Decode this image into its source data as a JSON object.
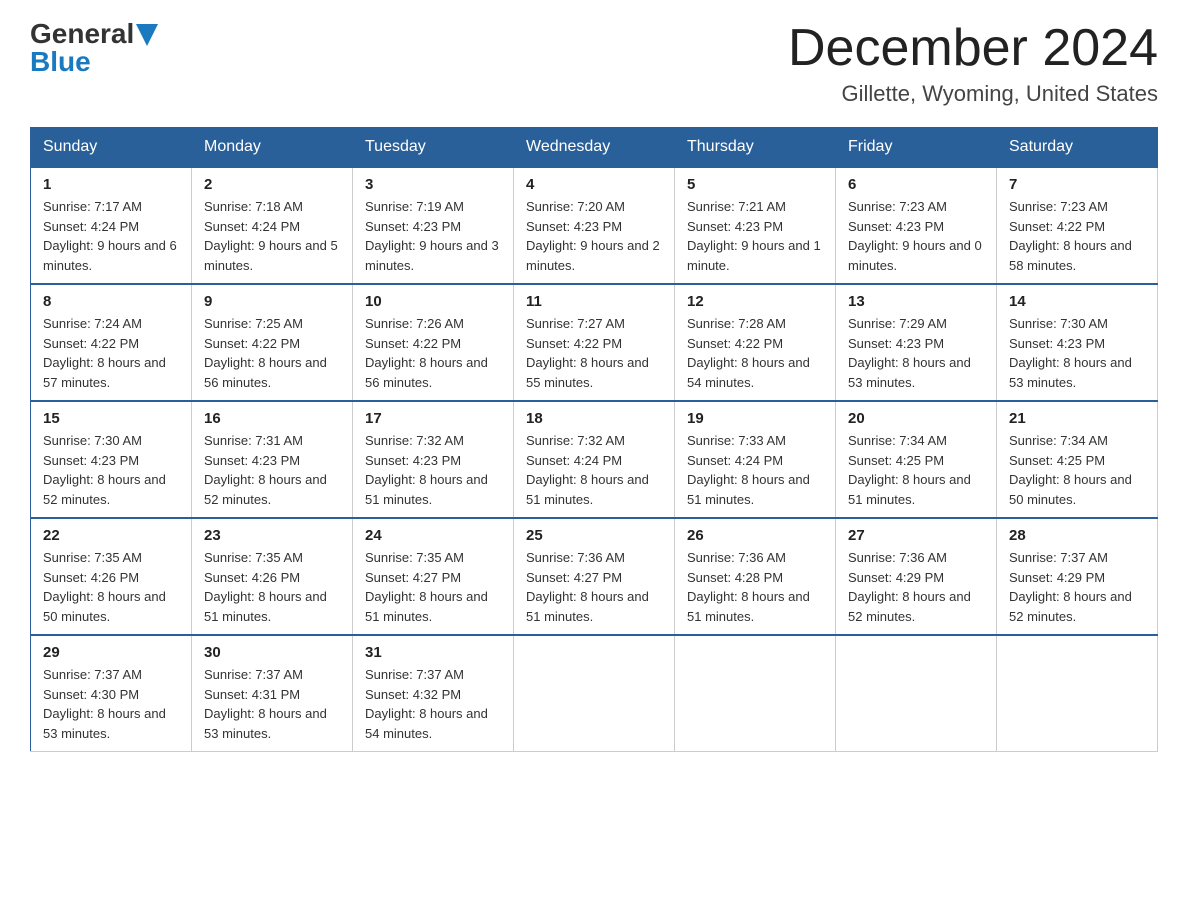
{
  "logo": {
    "general": "General",
    "blue": "Blue",
    "tagline": "GeneralBlue"
  },
  "title": "December 2024",
  "subtitle": "Gillette, Wyoming, United States",
  "days_of_week": [
    "Sunday",
    "Monday",
    "Tuesday",
    "Wednesday",
    "Thursday",
    "Friday",
    "Saturday"
  ],
  "weeks": [
    [
      {
        "day": "1",
        "sunrise": "7:17 AM",
        "sunset": "4:24 PM",
        "daylight": "9 hours and 6 minutes."
      },
      {
        "day": "2",
        "sunrise": "7:18 AM",
        "sunset": "4:24 PM",
        "daylight": "9 hours and 5 minutes."
      },
      {
        "day": "3",
        "sunrise": "7:19 AM",
        "sunset": "4:23 PM",
        "daylight": "9 hours and 3 minutes."
      },
      {
        "day": "4",
        "sunrise": "7:20 AM",
        "sunset": "4:23 PM",
        "daylight": "9 hours and 2 minutes."
      },
      {
        "day": "5",
        "sunrise": "7:21 AM",
        "sunset": "4:23 PM",
        "daylight": "9 hours and 1 minute."
      },
      {
        "day": "6",
        "sunrise": "7:23 AM",
        "sunset": "4:23 PM",
        "daylight": "9 hours and 0 minutes."
      },
      {
        "day": "7",
        "sunrise": "7:23 AM",
        "sunset": "4:22 PM",
        "daylight": "8 hours and 58 minutes."
      }
    ],
    [
      {
        "day": "8",
        "sunrise": "7:24 AM",
        "sunset": "4:22 PM",
        "daylight": "8 hours and 57 minutes."
      },
      {
        "day": "9",
        "sunrise": "7:25 AM",
        "sunset": "4:22 PM",
        "daylight": "8 hours and 56 minutes."
      },
      {
        "day": "10",
        "sunrise": "7:26 AM",
        "sunset": "4:22 PM",
        "daylight": "8 hours and 56 minutes."
      },
      {
        "day": "11",
        "sunrise": "7:27 AM",
        "sunset": "4:22 PM",
        "daylight": "8 hours and 55 minutes."
      },
      {
        "day": "12",
        "sunrise": "7:28 AM",
        "sunset": "4:22 PM",
        "daylight": "8 hours and 54 minutes."
      },
      {
        "day": "13",
        "sunrise": "7:29 AM",
        "sunset": "4:23 PM",
        "daylight": "8 hours and 53 minutes."
      },
      {
        "day": "14",
        "sunrise": "7:30 AM",
        "sunset": "4:23 PM",
        "daylight": "8 hours and 53 minutes."
      }
    ],
    [
      {
        "day": "15",
        "sunrise": "7:30 AM",
        "sunset": "4:23 PM",
        "daylight": "8 hours and 52 minutes."
      },
      {
        "day": "16",
        "sunrise": "7:31 AM",
        "sunset": "4:23 PM",
        "daylight": "8 hours and 52 minutes."
      },
      {
        "day": "17",
        "sunrise": "7:32 AM",
        "sunset": "4:23 PM",
        "daylight": "8 hours and 51 minutes."
      },
      {
        "day": "18",
        "sunrise": "7:32 AM",
        "sunset": "4:24 PM",
        "daylight": "8 hours and 51 minutes."
      },
      {
        "day": "19",
        "sunrise": "7:33 AM",
        "sunset": "4:24 PM",
        "daylight": "8 hours and 51 minutes."
      },
      {
        "day": "20",
        "sunrise": "7:34 AM",
        "sunset": "4:25 PM",
        "daylight": "8 hours and 51 minutes."
      },
      {
        "day": "21",
        "sunrise": "7:34 AM",
        "sunset": "4:25 PM",
        "daylight": "8 hours and 50 minutes."
      }
    ],
    [
      {
        "day": "22",
        "sunrise": "7:35 AM",
        "sunset": "4:26 PM",
        "daylight": "8 hours and 50 minutes."
      },
      {
        "day": "23",
        "sunrise": "7:35 AM",
        "sunset": "4:26 PM",
        "daylight": "8 hours and 51 minutes."
      },
      {
        "day": "24",
        "sunrise": "7:35 AM",
        "sunset": "4:27 PM",
        "daylight": "8 hours and 51 minutes."
      },
      {
        "day": "25",
        "sunrise": "7:36 AM",
        "sunset": "4:27 PM",
        "daylight": "8 hours and 51 minutes."
      },
      {
        "day": "26",
        "sunrise": "7:36 AM",
        "sunset": "4:28 PM",
        "daylight": "8 hours and 51 minutes."
      },
      {
        "day": "27",
        "sunrise": "7:36 AM",
        "sunset": "4:29 PM",
        "daylight": "8 hours and 52 minutes."
      },
      {
        "day": "28",
        "sunrise": "7:37 AM",
        "sunset": "4:29 PM",
        "daylight": "8 hours and 52 minutes."
      }
    ],
    [
      {
        "day": "29",
        "sunrise": "7:37 AM",
        "sunset": "4:30 PM",
        "daylight": "8 hours and 53 minutes."
      },
      {
        "day": "30",
        "sunrise": "7:37 AM",
        "sunset": "4:31 PM",
        "daylight": "8 hours and 53 minutes."
      },
      {
        "day": "31",
        "sunrise": "7:37 AM",
        "sunset": "4:32 PM",
        "daylight": "8 hours and 54 minutes."
      },
      null,
      null,
      null,
      null
    ]
  ],
  "labels": {
    "sunrise_prefix": "Sunrise: ",
    "sunset_prefix": "Sunset: ",
    "daylight_prefix": "Daylight: "
  }
}
